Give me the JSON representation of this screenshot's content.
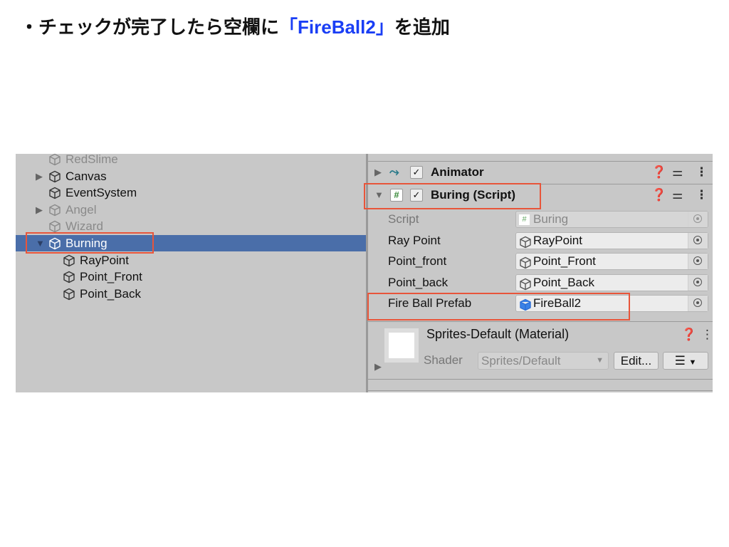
{
  "instruction": {
    "prefix": "・チェックが完了したら空欄に",
    "highlight": "「FireBall2」",
    "suffix": "を追加",
    "highlight_color": "#1a3ef5"
  },
  "hierarchy": {
    "items": [
      {
        "label": "RedSlime",
        "inactive": true,
        "expander": false
      },
      {
        "label": "Canvas",
        "inactive": false,
        "expander": "collapsed"
      },
      {
        "label": "EventSystem",
        "inactive": false,
        "expander": false
      },
      {
        "label": "Angel",
        "inactive": true,
        "expander": "collapsed"
      },
      {
        "label": "Wizard",
        "inactive": true,
        "expander": false
      },
      {
        "label": "Burning",
        "inactive": false,
        "expander": "expanded",
        "selected": true
      },
      {
        "label": "RayPoint",
        "child": true
      },
      {
        "label": "Point_Front",
        "child": true
      },
      {
        "label": "Point_Back",
        "child": true
      }
    ],
    "selection_color": "#4a6ea9"
  },
  "inspector": {
    "animator": {
      "label": "Animator",
      "enabled": true
    },
    "script_component": {
      "label": "Buring (Script)",
      "enabled": true
    },
    "fields": [
      {
        "label": "Script",
        "value": "Buring",
        "icon": "script-icon",
        "disabled": true
      },
      {
        "label": "Ray Point",
        "value": "RayPoint",
        "icon": "gameobject-icon"
      },
      {
        "label": "Point_front",
        "value": "Point_Front",
        "icon": "gameobject-icon"
      },
      {
        "label": "Point_back",
        "value": "Point_Back",
        "icon": "gameobject-icon"
      },
      {
        "label": "Fire Ball Prefab",
        "value": "FireBall2",
        "icon": "prefab-icon"
      }
    ],
    "material": {
      "title": "Sprites-Default (Material)",
      "shader_label": "Shader",
      "shader_value": "Sprites/Default",
      "edit_label": "Edit..."
    }
  },
  "highlight_color": "#e8553a"
}
